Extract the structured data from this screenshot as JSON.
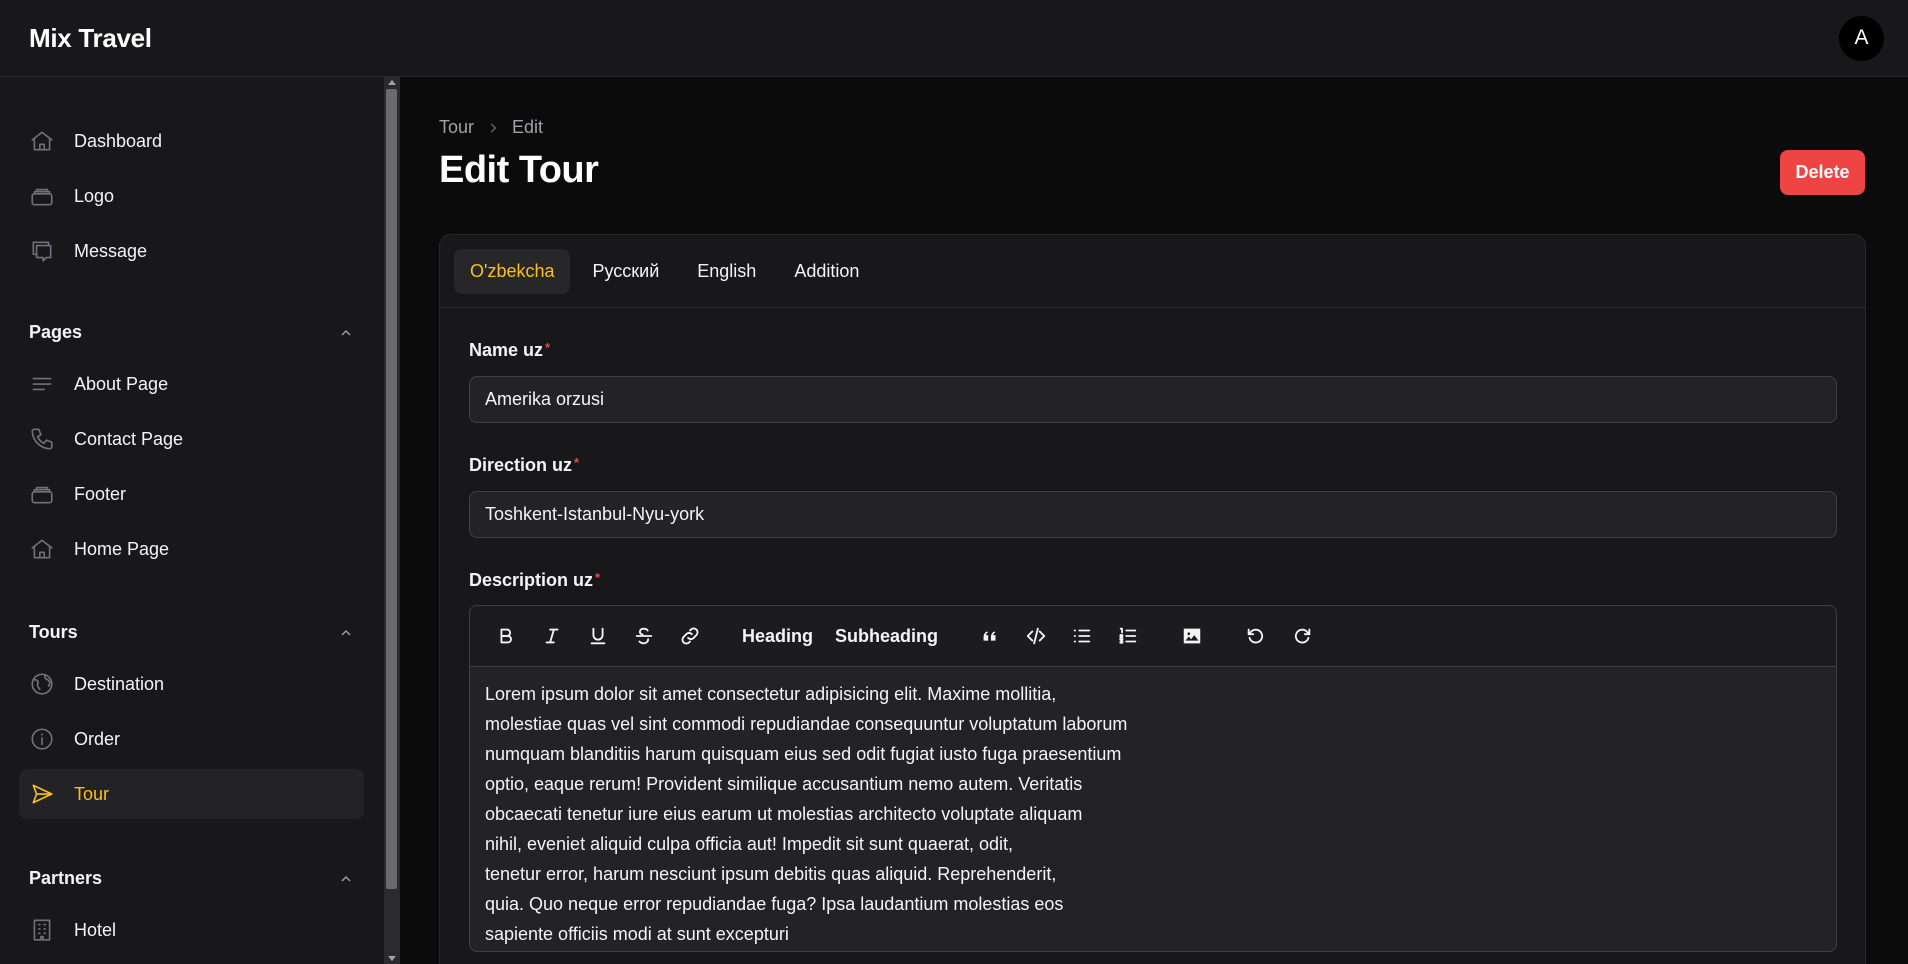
{
  "app": {
    "title": "Mix Travel",
    "avatar_initial": "A"
  },
  "sidebar": {
    "top_items": [
      {
        "label": "Dashboard",
        "icon": "home-icon"
      },
      {
        "label": "Logo",
        "icon": "stack-icon"
      },
      {
        "label": "Message",
        "icon": "chat-icon"
      }
    ],
    "groups": [
      {
        "title": "Pages",
        "items": [
          {
            "label": "About Page",
            "icon": "lines-icon"
          },
          {
            "label": "Contact Page",
            "icon": "phone-icon"
          },
          {
            "label": "Footer",
            "icon": "stack-icon"
          },
          {
            "label": "Home Page",
            "icon": "home-icon"
          }
        ]
      },
      {
        "title": "Tours",
        "items": [
          {
            "label": "Destination",
            "icon": "globe-icon"
          },
          {
            "label": "Order",
            "icon": "info-icon"
          },
          {
            "label": "Tour",
            "icon": "paper-plane-icon",
            "active": true
          }
        ]
      },
      {
        "title": "Partners",
        "items": [
          {
            "label": "Hotel",
            "icon": "building-icon"
          }
        ]
      }
    ]
  },
  "breadcrumb": {
    "root": "Tour",
    "current": "Edit"
  },
  "page": {
    "title": "Edit Tour",
    "delete_label": "Delete"
  },
  "tabs": [
    {
      "label": "O'zbekcha",
      "active": true
    },
    {
      "label": "Русский"
    },
    {
      "label": "English"
    },
    {
      "label": "Addition"
    }
  ],
  "form": {
    "name": {
      "label": "Name uz",
      "required_mark": "*",
      "value": "Amerika orzusi"
    },
    "direction": {
      "label": "Direction uz",
      "required_mark": "*",
      "value": "Toshkent-Istanbul-Nyu-york"
    },
    "description": {
      "label": "Description uz",
      "required_mark": "*",
      "toolbar": {
        "heading": "Heading",
        "subheading": "Subheading"
      },
      "lines": [
        "Lorem ipsum dolor sit amet consectetur adipisicing elit. Maxime mollitia,",
        "molestiae quas vel sint commodi repudiandae consequuntur voluptatum laborum",
        "numquam blanditiis harum quisquam eius sed odit fugiat iusto fuga praesentium",
        "optio, eaque rerum! Provident similique accusantium nemo autem. Veritatis",
        "obcaecati tenetur iure eius earum ut molestias architecto voluptate aliquam",
        "nihil, eveniet aliquid culpa officia aut! Impedit sit sunt quaerat, odit,",
        "tenetur error, harum nesciunt ipsum debitis quas aliquid. Reprehenderit,",
        "quia. Quo neque error repudiandae fuga? Ipsa laudantium molestias eos",
        "sapiente officiis modi at sunt excepturi"
      ]
    }
  },
  "colors": {
    "accent": "#fbbf24",
    "danger": "#ef4444",
    "background": "#0b0b0c",
    "panel": "#18181b"
  }
}
